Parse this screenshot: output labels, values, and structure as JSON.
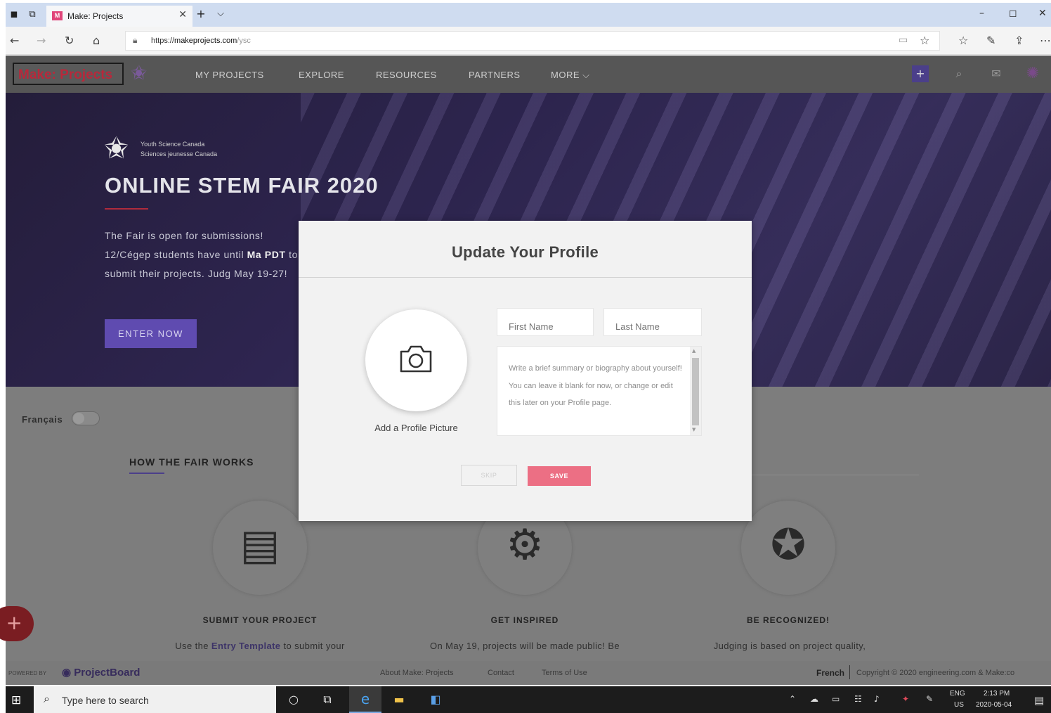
{
  "browser": {
    "tab_title": "Make: Projects",
    "tab_favicon": "M",
    "url_prefix": "https://",
    "url_host": "makeprojects.com",
    "url_path": "/ysc"
  },
  "site_header": {
    "logo_text": "Make: Projects",
    "nav": [
      "MY PROJECTS",
      "EXPLORE",
      "RESOURCES",
      "PARTNERS",
      "MORE ⌵"
    ]
  },
  "hero": {
    "org_line1": "Youth Science Canada",
    "org_line2": "Sciences jeunesse Canada",
    "title": "ONLINE STEM FAIR 2020",
    "body_lead": "The Fair is open for submissions! 12/Cégep students have until ",
    "body_bold1": "Ma",
    "body_mid": " ",
    "body_bold2": "PDT",
    "body_tail": " to submit their projects. Judg May 19-27!",
    "cta": "ENTER NOW"
  },
  "page": {
    "francais_label": "Français",
    "section_title": "HOW THE FAIR WORKS",
    "features": [
      {
        "title": "SUBMIT YOUR PROJECT",
        "text_pre": "Use the ",
        "text_link": "Entry Template",
        "text_post": " to submit your"
      },
      {
        "title": "GET INSPIRED",
        "text_pre": "On May 19, projects will be made public! Be",
        "text_link": "",
        "text_post": ""
      },
      {
        "title": "BE RECOGNIZED!",
        "text_pre": "Judging is based on project quality,",
        "text_link": "",
        "text_post": ""
      }
    ]
  },
  "footer": {
    "powered_by": "POWERED BY",
    "brand": "ProjectBoard",
    "links": [
      "About Make: Projects",
      "Contact",
      "Terms of Use"
    ],
    "language": "French",
    "copyright": "Copyright © 2020 engineering.com & Make:co"
  },
  "modal": {
    "title": "Update Your Profile",
    "avatar_label": "Add a Profile Picture",
    "first_name_placeholder": "First Name",
    "last_name_placeholder": "Last Name",
    "bio_placeholder": "Write a brief summary or biography about yourself! You can leave it blank for now, or change or edit this later on your Profile page.",
    "skip_label": "SKIP",
    "save_label": "SAVE",
    "accent_color": "#ec6f84"
  },
  "taskbar": {
    "search_placeholder": "Type here to search",
    "lang_line1": "ENG",
    "lang_line2": "US",
    "time": "2:13 PM",
    "date": "2020-05-04"
  }
}
